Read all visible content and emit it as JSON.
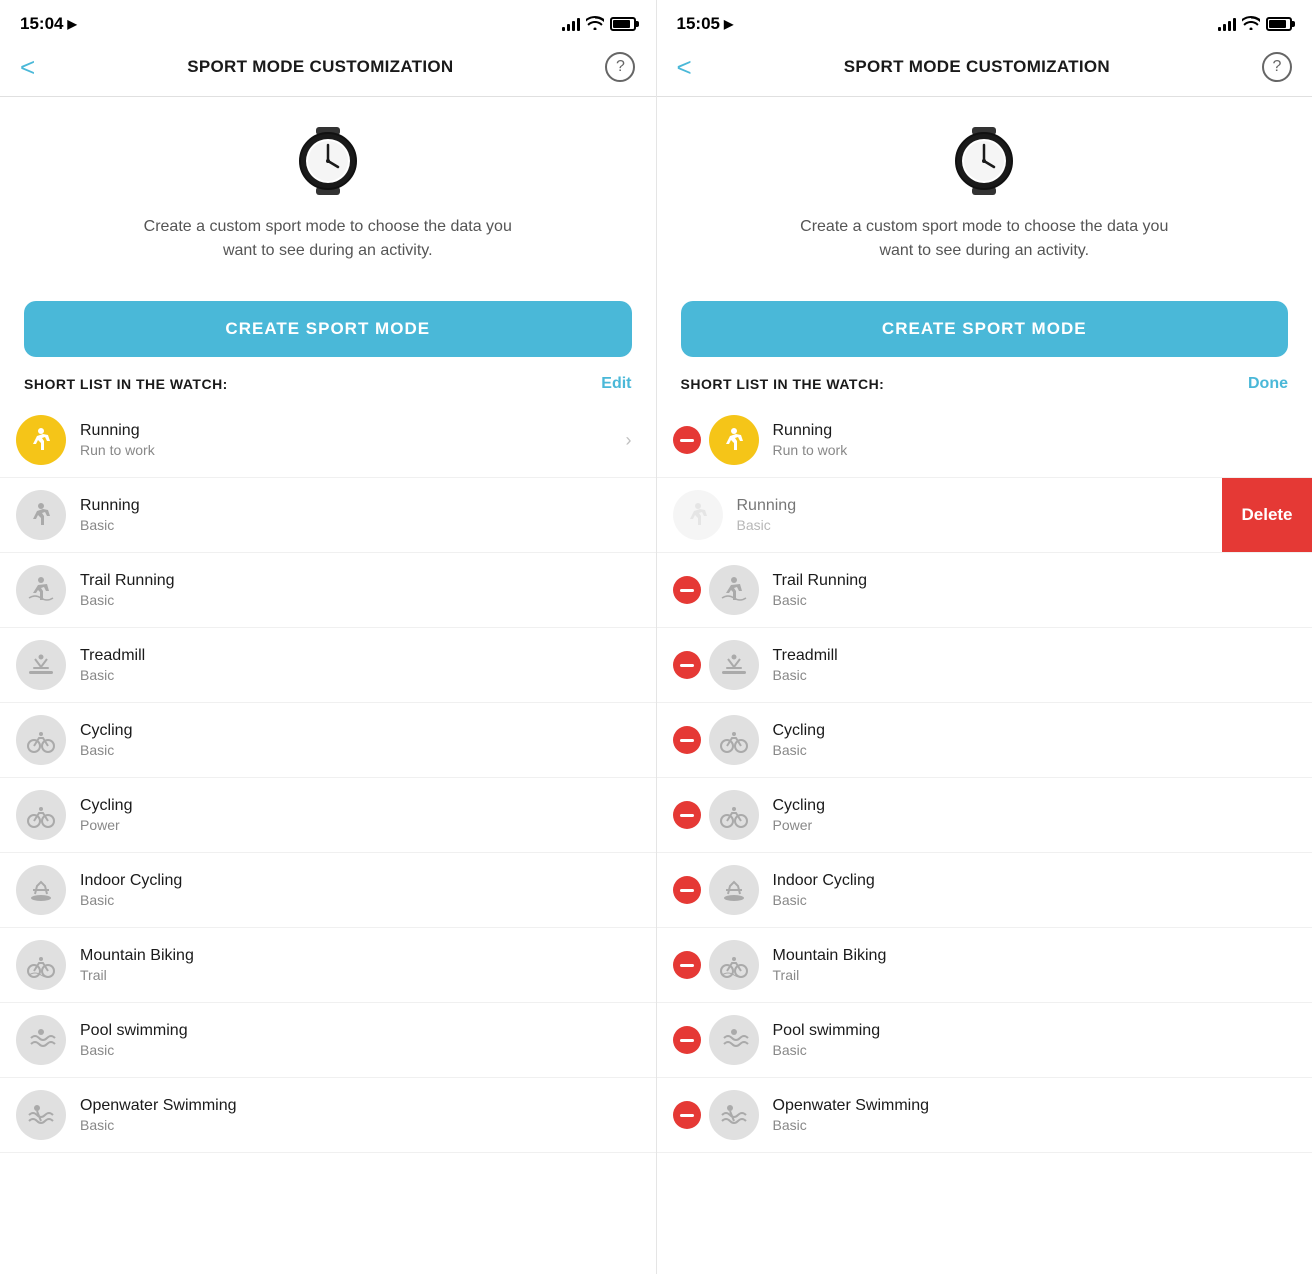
{
  "screen1": {
    "statusBar": {
      "time": "15:04",
      "hasLocation": true
    },
    "navTitle": "SPORT MODE CUSTOMIZATION",
    "backLabel": "<",
    "helpLabel": "?",
    "watchDesc": "Create a custom sport mode to choose the data you want to see during an activity.",
    "createBtn": "CREATE SPORT MODE",
    "shortListTitle": "SHORT LIST IN THE WATCH:",
    "shortListAction": "Edit",
    "items": [
      {
        "name": "Running",
        "sub": "Run to work",
        "isYellow": true,
        "hasChevron": true
      },
      {
        "name": "Running",
        "sub": "Basic",
        "isYellow": false,
        "hasChevron": false
      },
      {
        "name": "Trail Running",
        "sub": "Basic",
        "isYellow": false
      },
      {
        "name": "Treadmill",
        "sub": "Basic",
        "isYellow": false
      },
      {
        "name": "Cycling",
        "sub": "Basic",
        "isYellow": false
      },
      {
        "name": "Cycling",
        "sub": "Power",
        "isYellow": false
      },
      {
        "name": "Indoor Cycling",
        "sub": "Basic",
        "isYellow": false
      },
      {
        "name": "Mountain Biking",
        "sub": "Trail",
        "isYellow": false
      },
      {
        "name": "Pool swimming",
        "sub": "Basic",
        "isYellow": false
      },
      {
        "name": "Openwater Swimming",
        "sub": "Basic",
        "isYellow": false
      }
    ]
  },
  "screen2": {
    "statusBar": {
      "time": "15:05",
      "hasLocation": true
    },
    "navTitle": "SPORT MODE CUSTOMIZATION",
    "backLabel": "<",
    "helpLabel": "?",
    "watchDesc": "Create a custom sport mode to choose the data you want to see during an activity.",
    "createBtn": "CREATE SPORT MODE",
    "shortListTitle": "SHORT LIST IN THE WATCH:",
    "shortListAction": "Done",
    "items": [
      {
        "name": "Running",
        "sub": "Run to work",
        "isYellow": true,
        "hasMinus": true,
        "showDelete": false
      },
      {
        "name": "Running",
        "sub": "Basic",
        "isYellow": false,
        "hasMinus": false,
        "showDelete": true,
        "deleteLabel": "Delete"
      },
      {
        "name": "Trail Running",
        "sub": "Basic",
        "isYellow": false,
        "hasMinus": true
      },
      {
        "name": "Treadmill",
        "sub": "Basic",
        "isYellow": false,
        "hasMinus": true
      },
      {
        "name": "Cycling",
        "sub": "Basic",
        "isYellow": false,
        "hasMinus": true
      },
      {
        "name": "Cycling",
        "sub": "Power",
        "isYellow": false,
        "hasMinus": true
      },
      {
        "name": "Indoor Cycling",
        "sub": "Basic",
        "isYellow": false,
        "hasMinus": true
      },
      {
        "name": "Mountain Biking",
        "sub": "Trail",
        "isYellow": false,
        "hasMinus": true
      },
      {
        "name": "Pool swimming",
        "sub": "Basic",
        "isYellow": false,
        "hasMinus": true
      },
      {
        "name": "Openwater Swimming",
        "sub": "Basic",
        "isYellow": false,
        "hasMinus": true
      }
    ]
  }
}
